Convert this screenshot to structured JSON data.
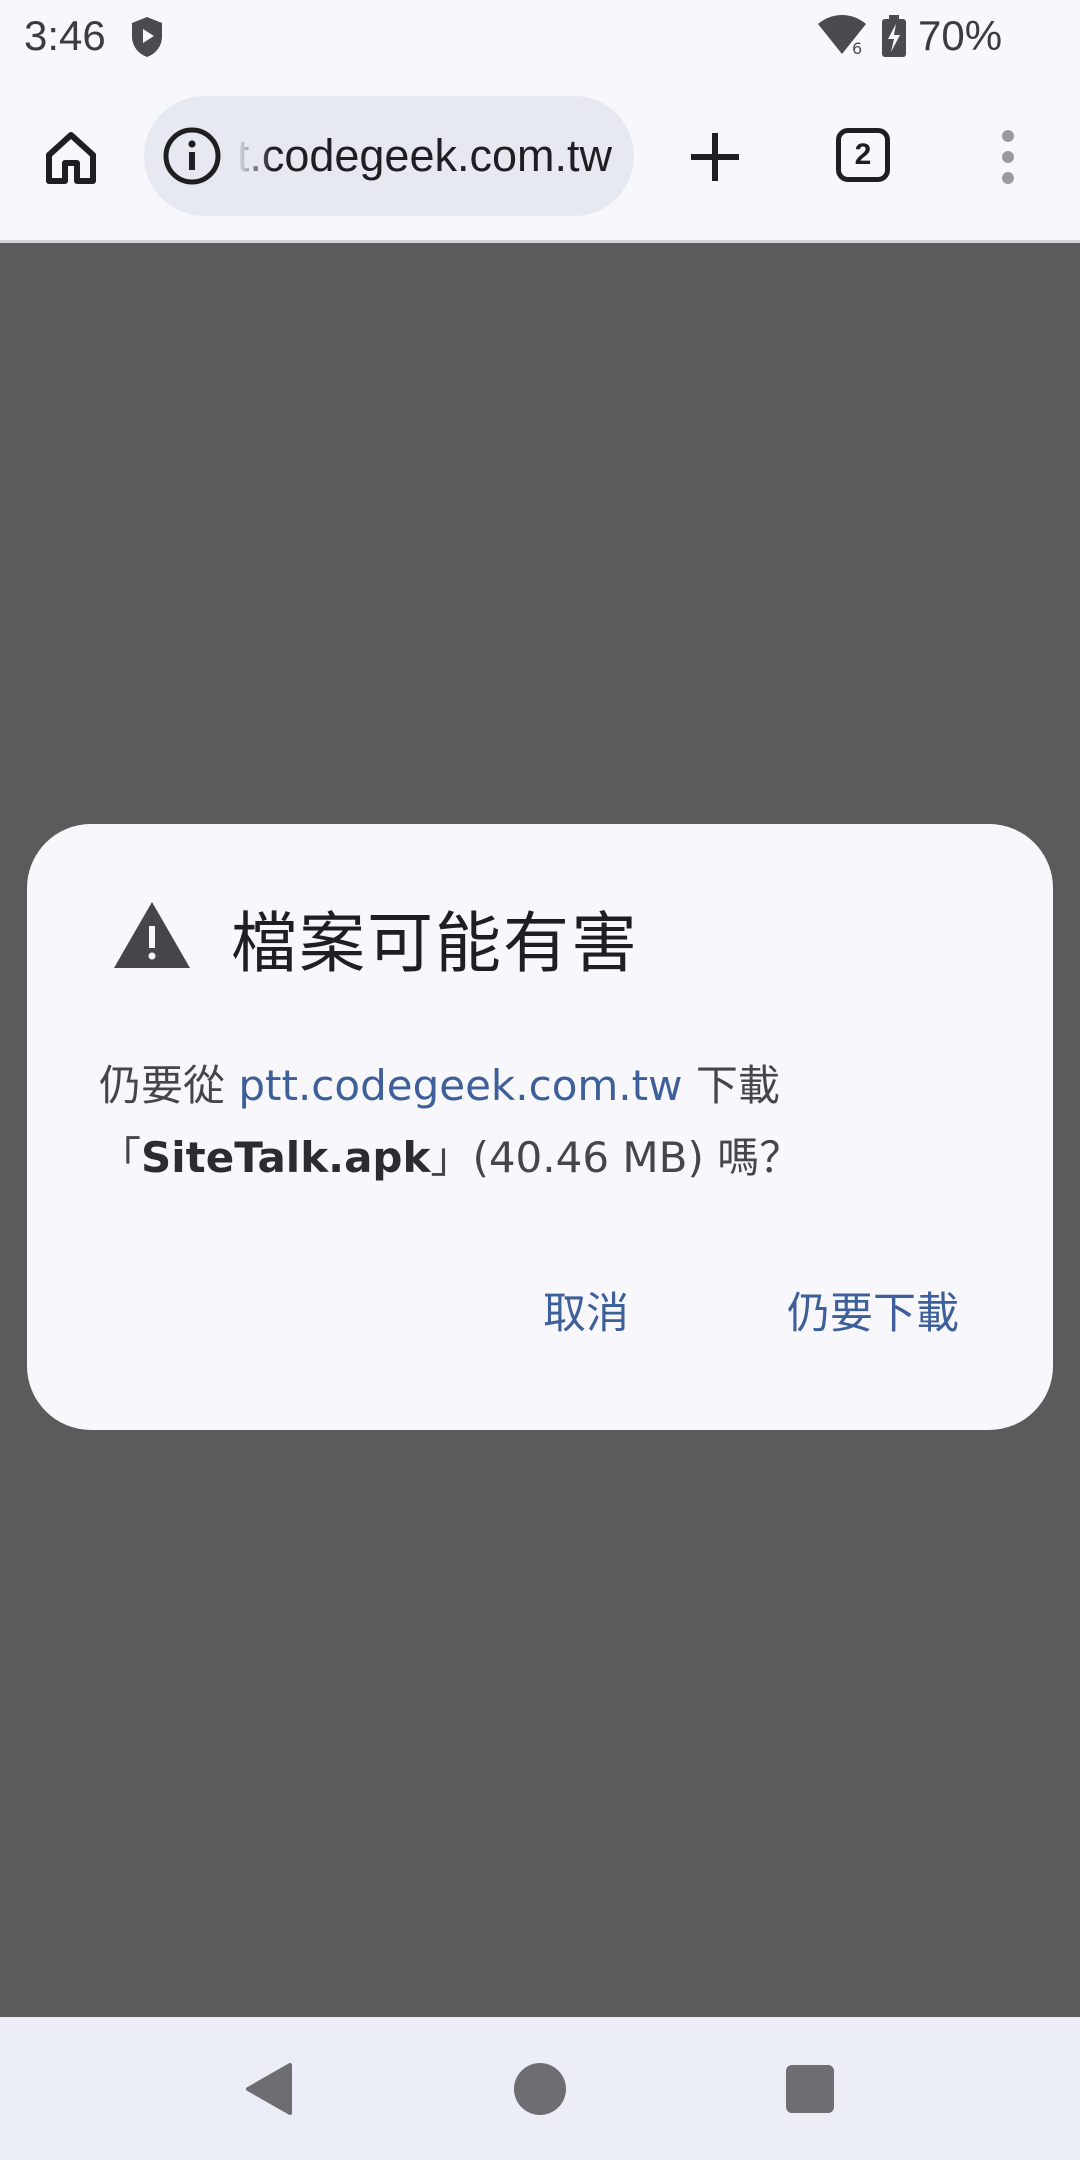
{
  "status_bar": {
    "time": "3:46",
    "battery_percent": "70%",
    "wifi_badge": "6"
  },
  "toolbar": {
    "url": "ptt.codegeek.com.tw",
    "tab_count": "2"
  },
  "dialog": {
    "title": "檔案可能有害",
    "message_prefix": "仍要從 ",
    "message_site": "ptt.codegeek.com.tw",
    "message_mid": " 下載",
    "message_file_open": "「",
    "message_filename": "SiteTalk.apk",
    "message_file_close": "」",
    "message_size": "(40.46 MB) 嗎？",
    "cancel_label": "取消",
    "download_label": "仍要下載"
  },
  "colors": {
    "accent": "#3d5f9a",
    "scrim": "#5b5b5c",
    "surface": "#f8f8fc"
  },
  "icons": [
    "shield-icon",
    "wifi-icon",
    "battery-charging-icon",
    "home-icon",
    "info-icon",
    "plus-icon",
    "more-vert-icon",
    "warning-icon",
    "back-icon",
    "home-circle-icon",
    "recents-icon"
  ]
}
